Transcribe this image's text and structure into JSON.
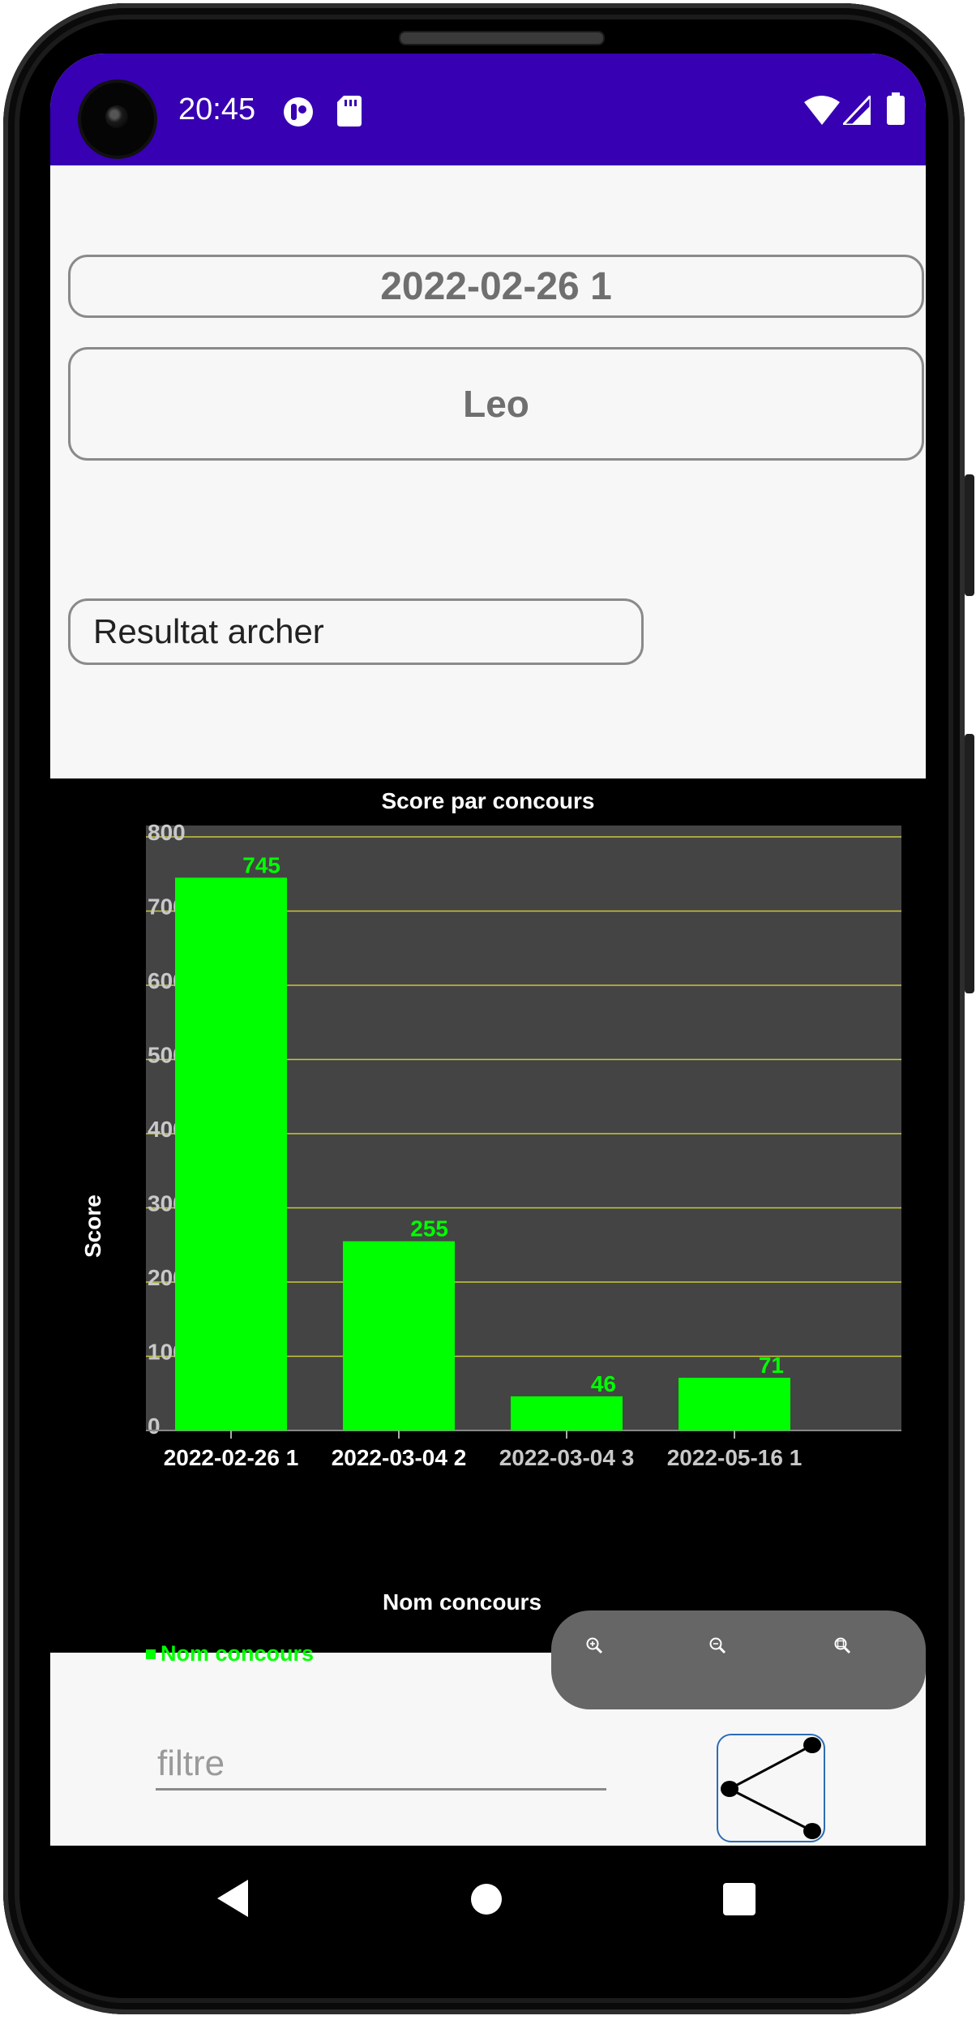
{
  "status_bar": {
    "time": "20:45"
  },
  "form": {
    "concours_name": "2022-02-26 1",
    "archer_name": "Leo",
    "result_button_label": "Resultat archer"
  },
  "chart_data": {
    "type": "bar",
    "title": "Score par concours",
    "xlabel": "Nom concours",
    "ylabel": "Score",
    "categories": [
      "2022-02-26 1",
      "2022-03-04 2",
      "2022-03-04 3",
      "2022-05-16 1"
    ],
    "series": [
      {
        "name": "Nom concours",
        "values": [
          745,
          255,
          46,
          71
        ]
      }
    ],
    "ylim": [
      0,
      800
    ],
    "yticks": [
      0,
      100,
      200,
      300,
      400,
      500,
      600,
      700,
      800
    ],
    "grid": true,
    "legend_position": "bottom-left",
    "colors": {
      "bar": "#00ff00",
      "plot_bg": "#444444",
      "grid": "#c8c83c",
      "page_bg": "#000000"
    }
  },
  "zoom_controls": {
    "icons": [
      "zoom-in-icon",
      "zoom-out-icon",
      "zoom-reset-icon"
    ]
  },
  "filter": {
    "placeholder": "filtre",
    "value": ""
  },
  "share": {
    "icon": "share-icon"
  },
  "nav": {
    "icons": [
      "back-icon",
      "home-icon",
      "recents-icon"
    ]
  },
  "colors": {
    "status_bar": "#3700b3",
    "share_border": "#2c6db5"
  }
}
